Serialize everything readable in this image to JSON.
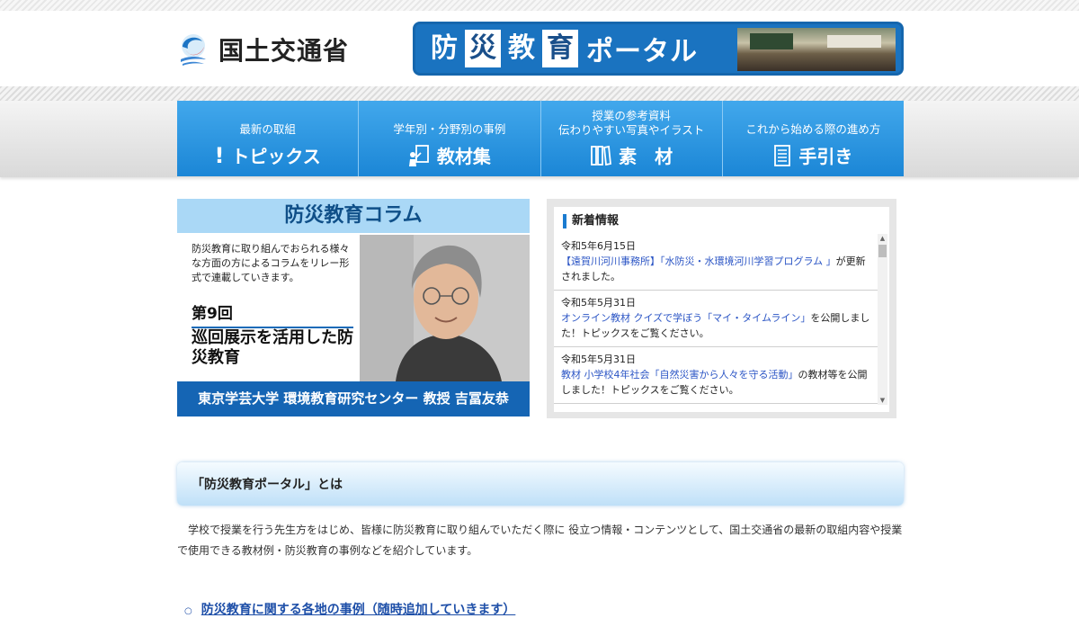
{
  "header": {
    "ministry_name": "国土交通省",
    "portal_title_chars": [
      "防",
      "災",
      "教",
      "育"
    ],
    "portal_title_rest": "ポータル"
  },
  "nav": [
    {
      "sub": "最新の取組",
      "main": "トピックス",
      "icon": "exclamation-icon"
    },
    {
      "sub": "学年別・分野別の事例",
      "main": "教材集",
      "icon": "teaching-materials-icon"
    },
    {
      "sub": "授業の参考資料\n伝わりやすい写真やイラスト",
      "main": "素　材",
      "icon": "book-icon"
    },
    {
      "sub": "これから始める際の進め方",
      "main": "手引き",
      "icon": "document-icon"
    }
  ],
  "column": {
    "heading": "防災教育コラム",
    "description": "防災教育に取り組んでおられる様々な方面の方によるコラムをリレー形式で連載していきます。",
    "number": "第9回",
    "title": "巡回展示を活用した防災教育",
    "author": "東京学芸大学 環境教育研究センター 教授 吉冨友恭"
  },
  "news": {
    "heading": "新着情報",
    "items": [
      {
        "date": "令和5年6月15日",
        "link": "【遠賀川河川事務所】「水防災・水環境河川学習プログラム 」",
        "text": "が更新されました。"
      },
      {
        "date": "令和5年5月31日",
        "link": "オンライン教材 クイズで学ぼう「マイ・タイムライン」",
        "text": "を公開しました！トピックスをご覧ください。"
      },
      {
        "date": "令和5年5月31日",
        "link": "教材 小学校4年社会「自然災害から人々を守る活動」",
        "text": "の教材等を公開しました！トピックスをご覧ください。"
      }
    ]
  },
  "about": {
    "title": "「防災教育ポータル」とは",
    "text": "学校で授業を行う先生方をはじめ、皆様に防災教育に取り組んでいただく際に 役立つ情報・コンテンツとして、国土交通省の最新の取組内容や授業で使用できる教材例・防災教育の事例などを紹介しています。",
    "link": "防災教育に関する各地の事例（随時追加していきます）"
  },
  "colors": {
    "nav_blue": "#2a95e0",
    "banner_blue": "#1a73c0",
    "column_blue": "#1565b4",
    "link_blue": "#2b55c5"
  }
}
